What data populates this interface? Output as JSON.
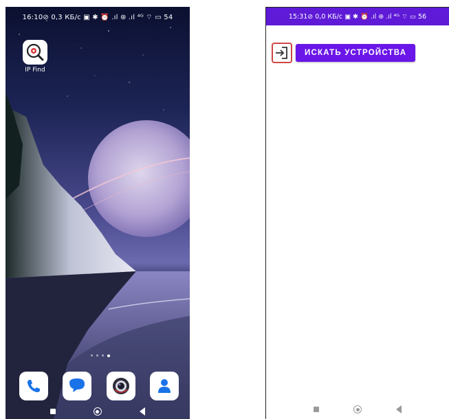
{
  "left_phone": {
    "status_bar": "16:10⊘  0,3 КБ/с ▣ ✱ ⏰ .ıl ⊛ .ıl ⁴ᴳ ⌔ ▭ 54",
    "app": {
      "label": "IP Find",
      "icon": "magnifier-icon"
    },
    "dock": [
      "phone-icon",
      "messages-icon",
      "camera-icon",
      "contacts-icon"
    ],
    "nav": [
      "recents-icon",
      "home-icon",
      "back-icon"
    ]
  },
  "right_phone": {
    "status_bar": "15:31⊘  0,0 КБ/с ▣ ✱ ⏰ .ıl ⊛ .ıl ⁴ᴳ ⌔ ▭ 56",
    "login_button_icon": "login-arrow-icon",
    "search_button": "ИСКАТЬ УСТРОЙСТВА",
    "nav": [
      "recents-icon",
      "home-icon",
      "back-icon"
    ]
  },
  "colors": {
    "accent": "#6a16e8",
    "status_bar_right": "#5e1ad6",
    "highlight_border": "#d04545"
  }
}
